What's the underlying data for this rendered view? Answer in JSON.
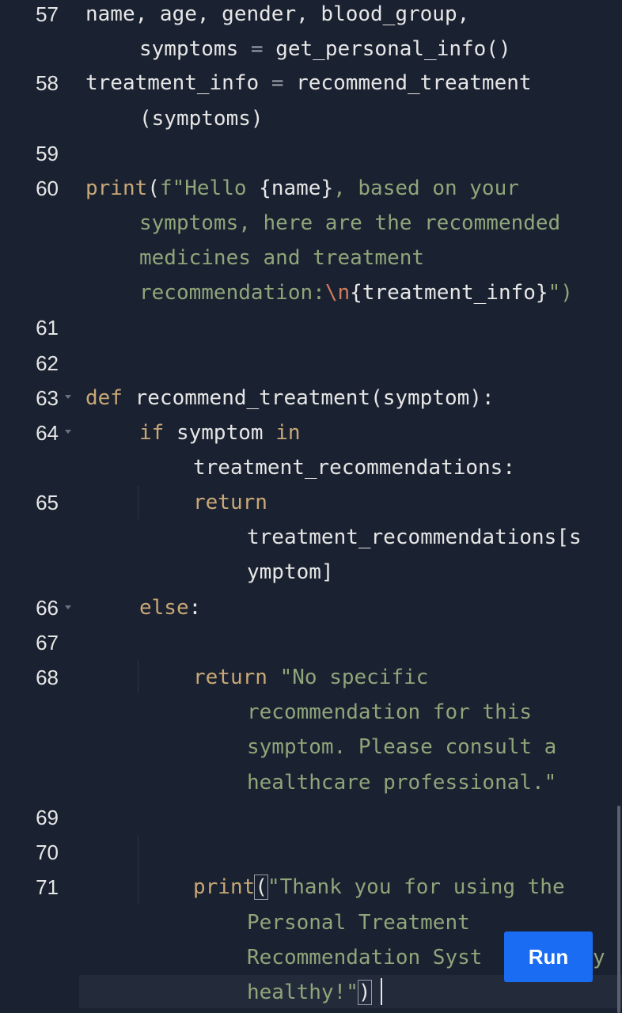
{
  "editor": {
    "line_numbers": [
      "57",
      "58",
      "59",
      "60",
      "61",
      "62",
      "63",
      "64",
      "65",
      "66",
      "67",
      "68",
      "69",
      "70",
      "71"
    ],
    "line57": {
      "a": "name, age, gender, blood_group,",
      "b": "symptoms ",
      "eq": "=",
      "c": " get_personal_info()"
    },
    "line58": {
      "a": "treatment_info ",
      "eq": "=",
      "b": " recommend_treatment",
      "c": "(symptoms)"
    },
    "line60": {
      "fn": "print",
      "paren": "(",
      "prefix": "f",
      "s1": "\"Hello ",
      "v1": "{name}",
      "s2": ", based on your",
      "s3": "symptoms, here are the recommended",
      "s4": "medicines and treatment",
      "s5": "recommendation:",
      "esc": "\\n",
      "v2": "{treatment_info}",
      "end": "\")"
    },
    "line63": {
      "kw": "def",
      "rest": " recommend_treatment(symptom):"
    },
    "line64": {
      "kw": "if",
      "mid": " symptom ",
      "kw2": "in",
      "cont": "treatment_recommendations:"
    },
    "line65": {
      "kw": "return",
      "c1": "treatment_recommendations[s",
      "c2": "ymptom]"
    },
    "line66": {
      "kw": "else",
      "colon": ":"
    },
    "line68": {
      "kw": "return",
      "s1": " \"No specific",
      "s2": "recommendation for this",
      "s3": "symptom. Please consult a",
      "s4": "healthcare professional.\""
    },
    "line71": {
      "fn": "print",
      "paren": "(",
      "s1": "\"Thank you for using the",
      "s2": "Personal Treatment",
      "s3": "Recommendation Syst",
      "s3end": "y",
      "s4": "healthy!\"",
      "close": ")"
    }
  },
  "run_button": {
    "label": "Run"
  }
}
